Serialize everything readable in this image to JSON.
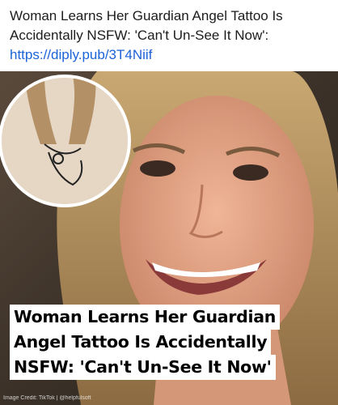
{
  "post": {
    "title": "Woman Learns Her Guardian Angel Tattoo Is Accidentally NSFW: 'Can't Un-See It Now':",
    "link": "https://diply.pub/3T4Niif"
  },
  "media": {
    "headline_lines": [
      "Woman Learns Her Guardian",
      "Angel Tattoo Is Accidentally",
      "NSFW: 'Can't Un-See It Now'"
    ],
    "credit": "Image Credit: TikTok | @helpfulsoft"
  }
}
